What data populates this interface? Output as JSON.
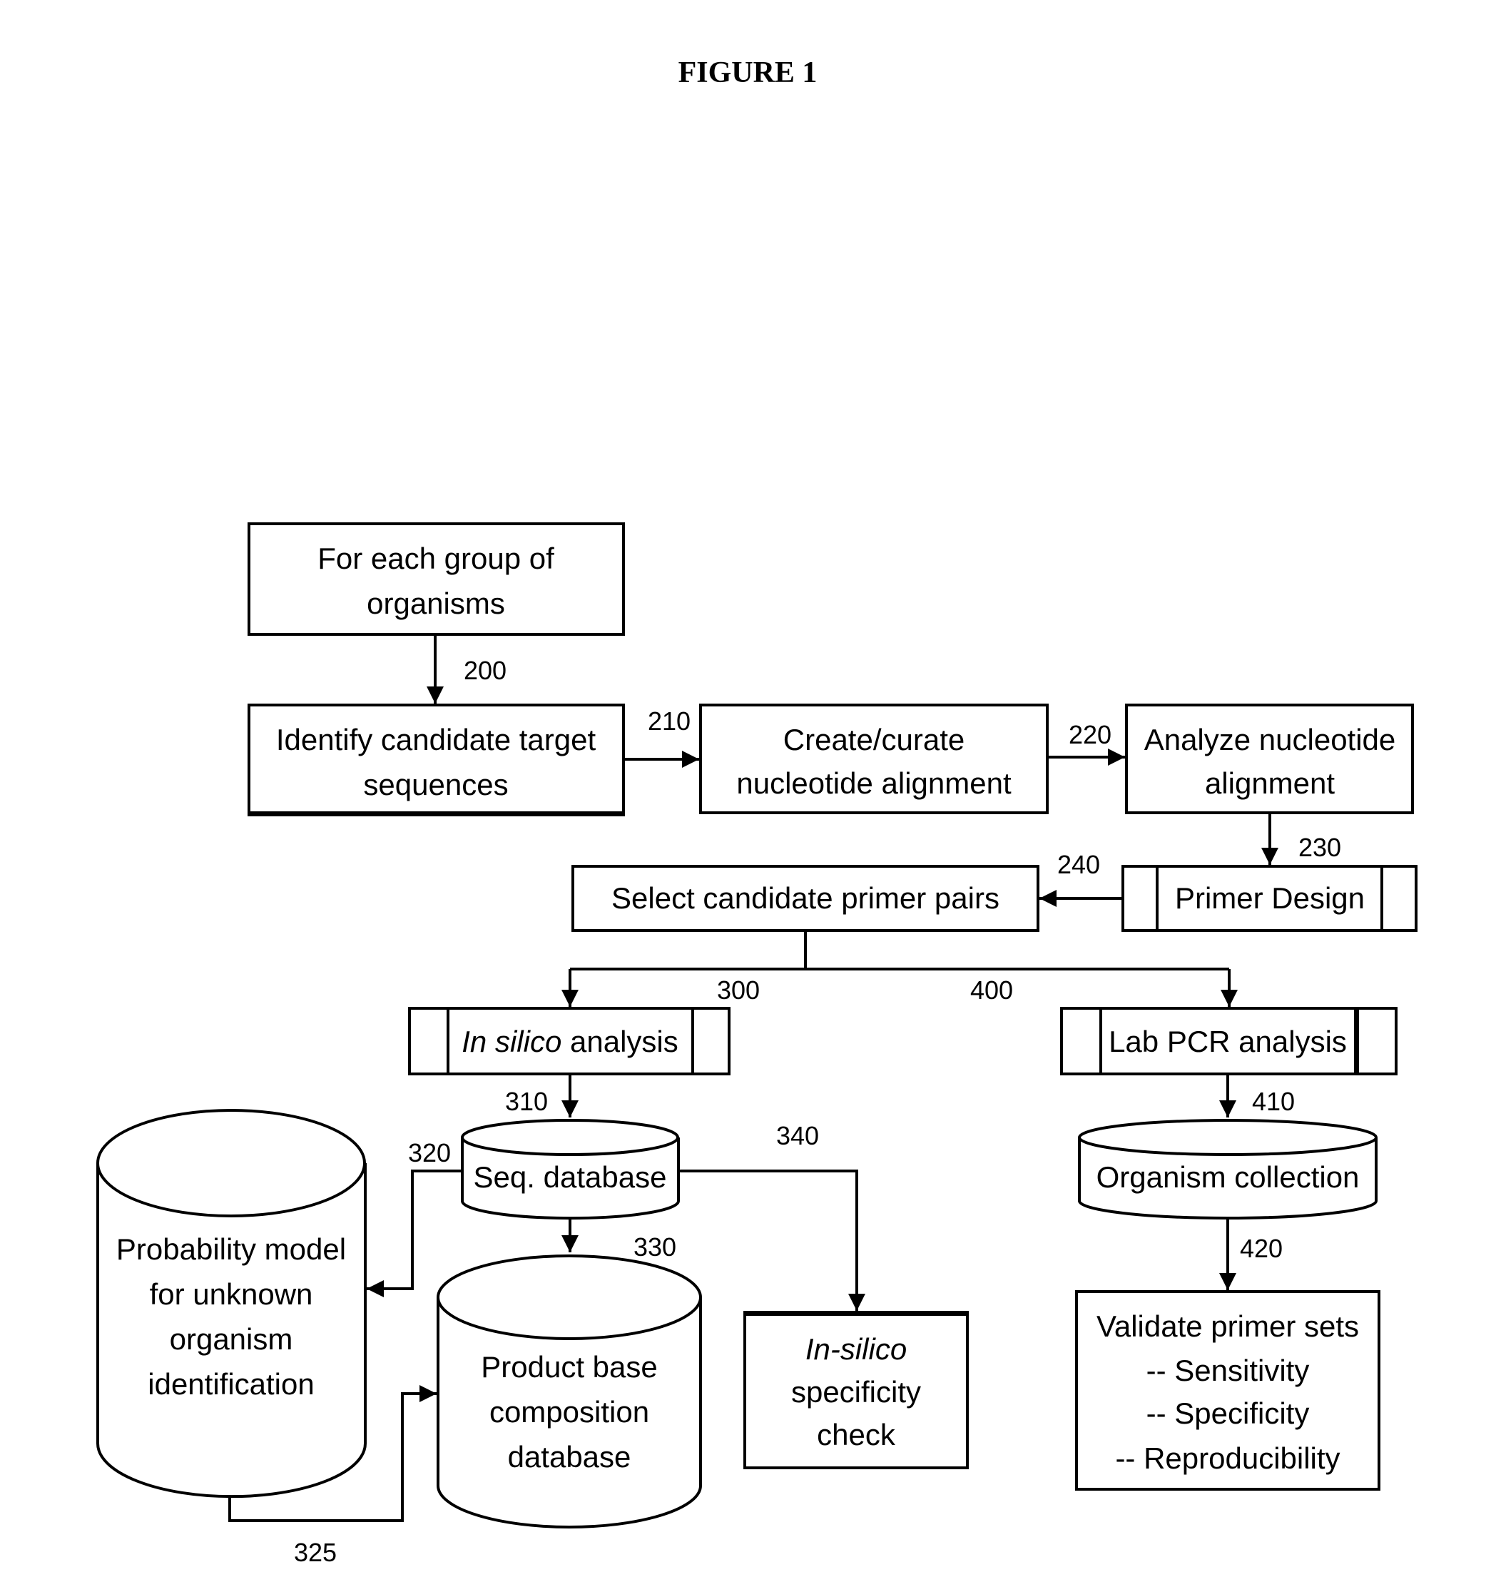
{
  "figure_title": "FIGURE 1",
  "nodes": {
    "group": {
      "lines": [
        "For each group of",
        "organisms"
      ]
    },
    "identify": {
      "lines": [
        "Identify candidate target",
        "sequences"
      ]
    },
    "curate": {
      "lines": [
        "Create/curate",
        "nucleotide alignment"
      ]
    },
    "analyze": {
      "lines": [
        "Analyze nucleotide",
        "alignment"
      ]
    },
    "primer_design": {
      "label": "Primer Design"
    },
    "select": {
      "label": "Select candidate primer pairs"
    },
    "in_silico": {
      "italic": "In silico",
      "rest": " analysis"
    },
    "lab_pcr": {
      "label": "Lab PCR analysis"
    },
    "seq_db": {
      "label": "Seq. database"
    },
    "organism_collection": {
      "label": "Organism collection"
    },
    "prob_model": {
      "lines": [
        "Probability model",
        "for unknown",
        "organism",
        "identification"
      ]
    },
    "product_base": {
      "lines": [
        "Product base",
        "composition",
        "database"
      ]
    },
    "specificity_check": {
      "italic": "In-silico",
      "lines": [
        "specificity",
        "check"
      ]
    },
    "validate": {
      "lines": [
        "Validate primer sets",
        "-- Sensitivity",
        "-- Specificity",
        "-- Reproducibility"
      ]
    }
  },
  "step_numbers": {
    "s200": "200",
    "s210": "210",
    "s220": "220",
    "s230": "230",
    "s240": "240",
    "s300": "300",
    "s310": "310",
    "s320": "320",
    "s325": "325",
    "s330": "330",
    "s340": "340",
    "s400": "400",
    "s410": "410",
    "s420": "420"
  }
}
